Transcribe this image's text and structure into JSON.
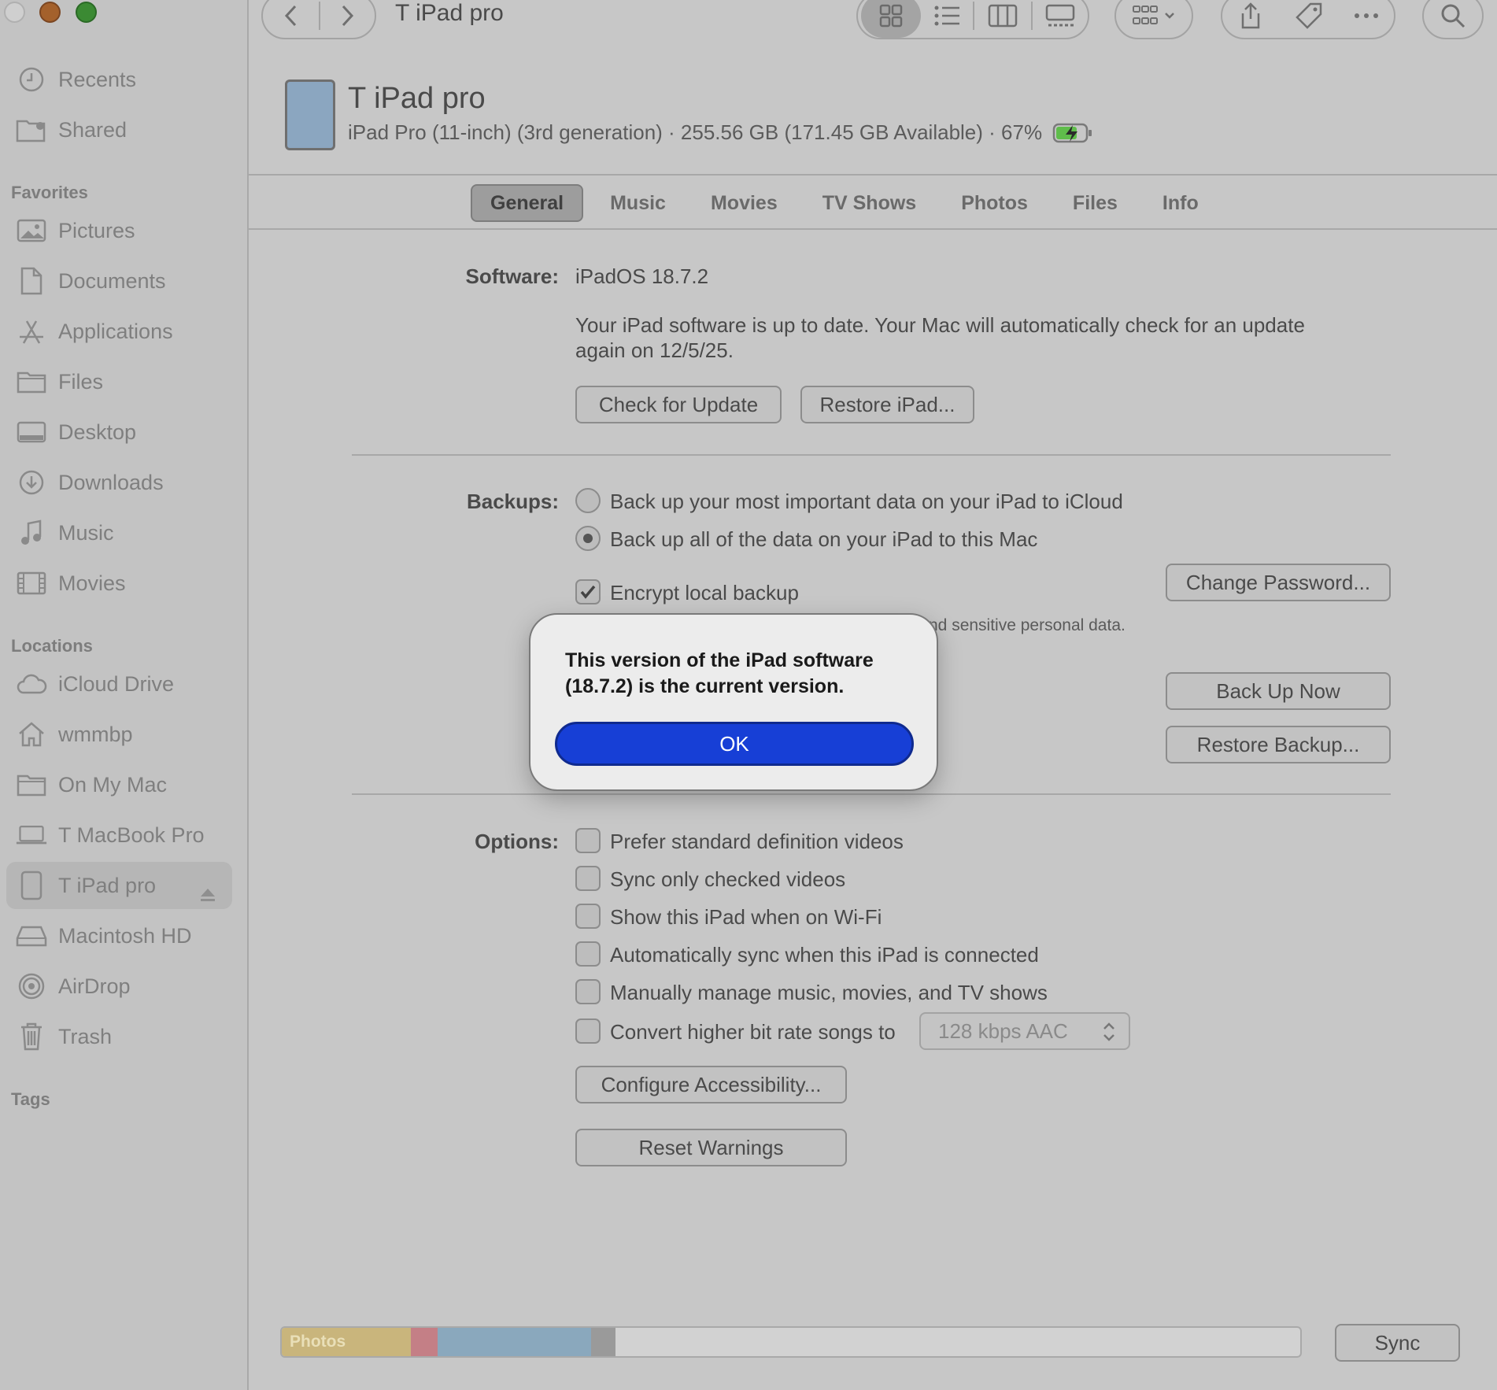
{
  "window": {
    "title": "T iPad pro"
  },
  "sidebar": {
    "items_top": [
      {
        "label": "Recents",
        "icon": "clock-icon"
      },
      {
        "label": "Shared",
        "icon": "shared-folder-icon"
      }
    ],
    "favorites_heading": "Favorites",
    "favorites": [
      {
        "label": "Pictures",
        "icon": "photo-icon"
      },
      {
        "label": "Documents",
        "icon": "document-icon"
      },
      {
        "label": "Applications",
        "icon": "app-store-icon"
      },
      {
        "label": "Files",
        "icon": "folder-icon"
      },
      {
        "label": "Desktop",
        "icon": "desktop-icon"
      },
      {
        "label": "Downloads",
        "icon": "download-icon"
      },
      {
        "label": "Music",
        "icon": "music-note-icon"
      },
      {
        "label": "Movies",
        "icon": "film-icon"
      }
    ],
    "locations_heading": "Locations",
    "locations": [
      {
        "label": "iCloud Drive",
        "icon": "cloud-icon"
      },
      {
        "label": "wmmbp",
        "icon": "home-icon"
      },
      {
        "label": "On My Mac",
        "icon": "folder-icon"
      },
      {
        "label": "T MacBook Pro",
        "icon": "laptop-icon"
      },
      {
        "label": "T iPad pro",
        "icon": "ipad-icon",
        "selected": true
      },
      {
        "label": "Macintosh HD",
        "icon": "hard-drive-icon"
      },
      {
        "label": "AirDrop",
        "icon": "airdrop-icon"
      },
      {
        "label": "Trash",
        "icon": "trash-icon"
      }
    ],
    "tags_heading": "Tags"
  },
  "device": {
    "name": "T iPad pro",
    "details": "iPad Pro (11-inch) (3rd generation) · 255.56 GB (171.45 GB Available) · 67%"
  },
  "tabs": [
    "General",
    "Music",
    "Movies",
    "TV Shows",
    "Photos",
    "Files",
    "Info"
  ],
  "software": {
    "label": "Software:",
    "version": "iPadOS 18.7.2",
    "status_line1": "Your iPad software is up to date. Your Mac will automatically check for an update",
    "status_line2": "again on 12/5/25.",
    "check_button": "Check for Update",
    "restore_button": "Restore iPad..."
  },
  "backups": {
    "label": "Backups:",
    "option_icloud": "Back up your most important data on your iPad to iCloud",
    "option_mac": "Back up all of the data on your iPad to this Mac",
    "encrypt": "Encrypt local backup",
    "encrypt_note": "nd sensitive personal data.",
    "change_password": "Change Password...",
    "back_up_now": "Back Up Now",
    "restore_backup": "Restore Backup..."
  },
  "options": {
    "label": "Options:",
    "items": [
      "Prefer standard definition videos",
      "Sync only checked videos",
      "Show this iPad when on Wi-Fi",
      "Automatically sync when this iPad is connected",
      "Manually manage music, movies, and TV shows",
      "Convert higher bit rate songs to"
    ],
    "bitrate_value": "128 kbps AAC",
    "configure_accessibility": "Configure Accessibility...",
    "reset_warnings": "Reset Warnings"
  },
  "dialog": {
    "message_line1": "This version of the iPad software",
    "message_line2": "(18.7.2) is the current version.",
    "ok": "OK"
  },
  "storage": {
    "photos_label": "Photos",
    "segments": [
      {
        "name": "photos",
        "fraction": 0.127,
        "color": "#c9b57c"
      },
      {
        "name": "apps",
        "fraction": 0.026,
        "color": "#c47f86"
      },
      {
        "name": "documents",
        "fraction": 0.151,
        "color": "#8aa8bd"
      },
      {
        "name": "other",
        "fraction": 0.024,
        "color": "#9a9a9a"
      }
    ]
  },
  "sync_button": "Sync",
  "colors": {
    "accent": "#173fd6",
    "close": "#c7c7c7",
    "minimize": "#a4612c",
    "maximize": "#3b8a33"
  }
}
